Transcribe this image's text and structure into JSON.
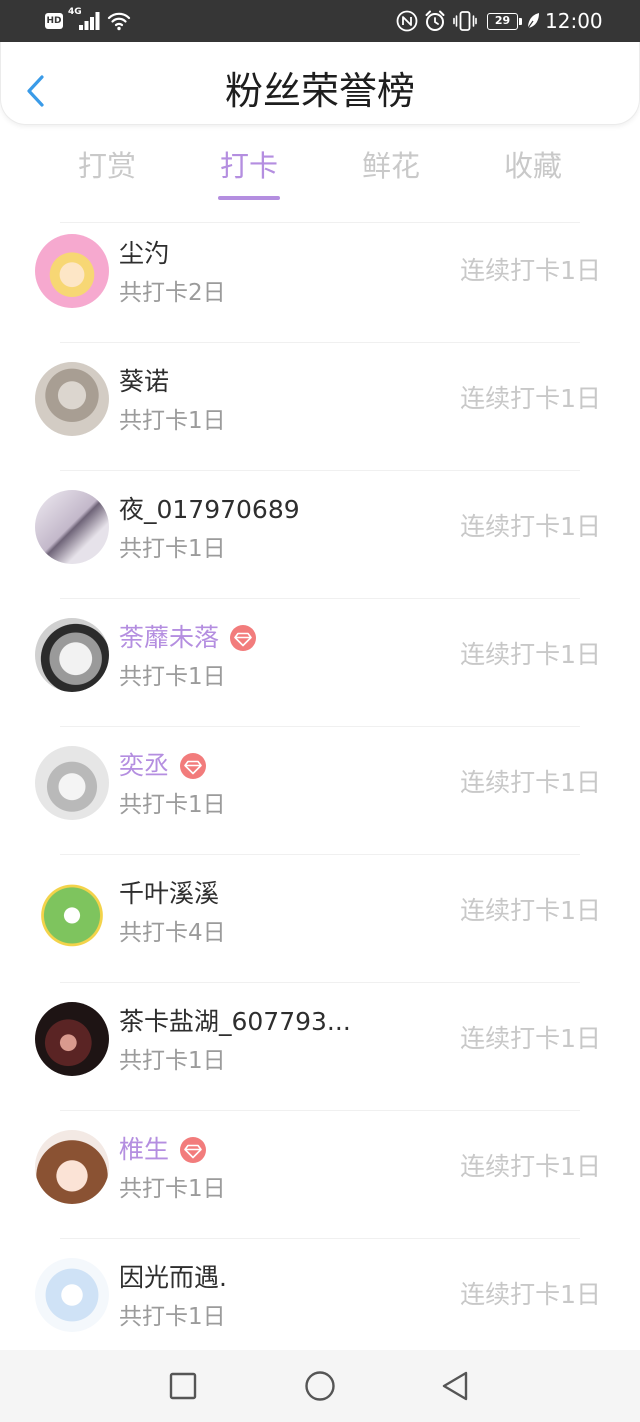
{
  "status_bar": {
    "hd_label": "HD",
    "network_label": "4G",
    "left_icons": [
      "signal-bars-icon",
      "wifi-icon"
    ],
    "right_icons": [
      "nfc-icon",
      "alarm-clock-icon",
      "vibrate-icon",
      "battery-icon",
      "power-saving-leaf-icon"
    ],
    "battery_level": "29",
    "time": "12:00"
  },
  "header": {
    "back_icon": "chevron-left-icon",
    "title": "粉丝荣誉榜"
  },
  "tabs": [
    {
      "label": "打赏",
      "active": false
    },
    {
      "label": "打卡",
      "active": true
    },
    {
      "label": "鲜花",
      "active": false
    },
    {
      "label": "收藏",
      "active": false
    }
  ],
  "fans": [
    {
      "name": "尘汋",
      "total": "共打卡2日",
      "streak": "连续打卡1日",
      "vip_badge": false
    },
    {
      "name": "葵诺",
      "total": "共打卡1日",
      "streak": "连续打卡1日",
      "vip_badge": false
    },
    {
      "name": "夜_017970689",
      "total": "共打卡1日",
      "streak": "连续打卡1日",
      "vip_badge": false
    },
    {
      "name": "荼蘼未落",
      "total": "共打卡1日",
      "streak": "连续打卡1日",
      "vip_badge": true
    },
    {
      "name": "奕丞",
      "total": "共打卡1日",
      "streak": "连续打卡1日",
      "vip_badge": true
    },
    {
      "name": "千叶溪溪",
      "total": "共打卡4日",
      "streak": "连续打卡1日",
      "vip_badge": false
    },
    {
      "name": "茶卡盐湖_607793...",
      "total": "共打卡1日",
      "streak": "连续打卡1日",
      "vip_badge": false
    },
    {
      "name": "椎生",
      "total": "共打卡1日",
      "streak": "连续打卡1日",
      "vip_badge": true
    },
    {
      "name": "因光而遇.",
      "total": "共打卡1日",
      "streak": "连续打卡1日",
      "vip_badge": false
    }
  ],
  "badge_icon": "diamond-badge-icon",
  "nav_bar": {
    "icons": [
      "recent-apps-square-icon",
      "home-circle-icon",
      "back-triangle-icon"
    ]
  },
  "colors": {
    "status_bar_bg": "#363636",
    "accent_purple": "#b48ee0",
    "back_blue": "#3a9be8",
    "badge_red": "#f27c7c",
    "inactive_gray": "#c9c9c9",
    "nav_bar_bg": "#f5f5f5"
  }
}
